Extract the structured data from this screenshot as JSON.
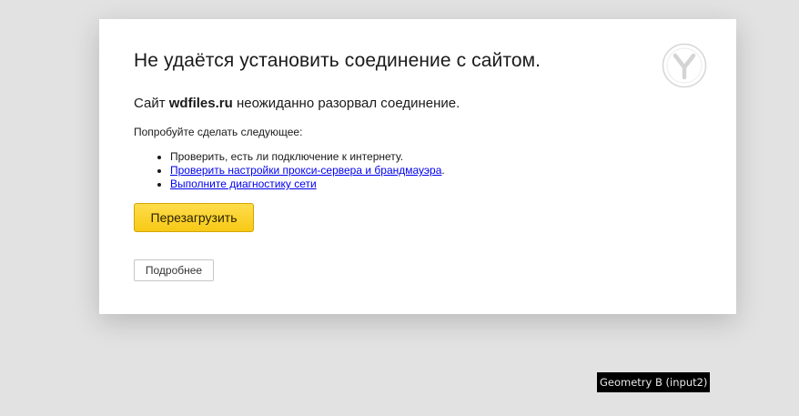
{
  "error_page": {
    "title": "Не удаётся установить соединение с сайтом.",
    "subtitle_prefix": "Сайт ",
    "host": "wdfiles.ru",
    "subtitle_suffix": " неожиданно разорвал соединение.",
    "try_heading": "Попробуйте сделать следующее:",
    "suggestions": [
      {
        "text": "Проверить, есть ли подключение к интернету."
      },
      {
        "link_text": "Проверить настройки прокси-сервера и брандмауэра",
        "trailing": "."
      },
      {
        "link_text": "Выполните диагностику сети"
      }
    ],
    "reload_label": "Перезагрузить",
    "details_label": "Подробнее",
    "logo_icon": "yandex-browser-logo-icon"
  },
  "overlay": {
    "label": "Geometry B (input2)"
  },
  "colors": {
    "page_background": "#e2e2e2",
    "card_background": "#ffffff",
    "reload_button": "#ffdb4d",
    "link": "#0000ee"
  }
}
